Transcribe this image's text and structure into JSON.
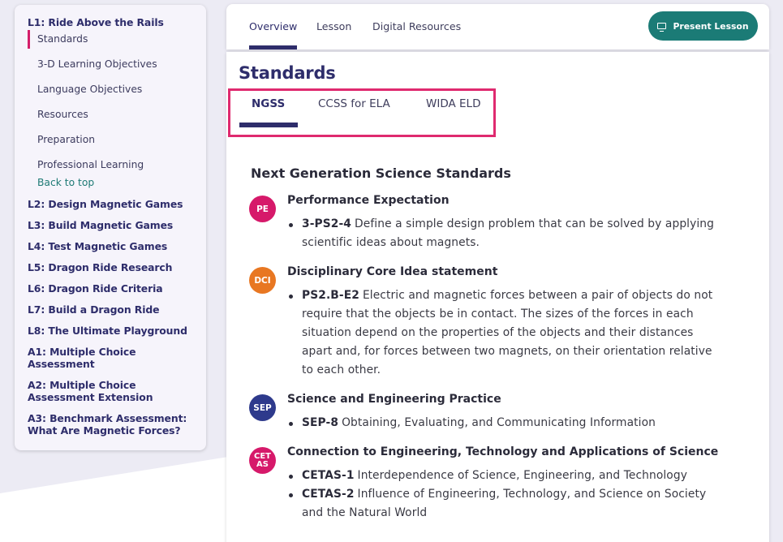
{
  "sidebar": {
    "current_lesson": "L1: Ride Above the Rails",
    "sub_items": [
      {
        "label": "Standards",
        "active": true
      },
      {
        "label": "3-D Learning Objectives"
      },
      {
        "label": "Language Objectives"
      },
      {
        "label": "Resources"
      },
      {
        "label": "Preparation"
      },
      {
        "label": "Professional Learning"
      }
    ],
    "back_to_top": "Back to top",
    "lessons": [
      "L2: Design Magnetic Games",
      "L3: Build Magnetic Games",
      "L4: Test Magnetic Games",
      "L5: Dragon Ride Research",
      "L6: Dragon Ride Criteria",
      "L7: Build a Dragon Ride",
      "L8: The Ultimate Playground",
      "A1: Multiple Choice Assessment",
      "A2: Multiple Choice Assessment Extension",
      "A3: Benchmark Assessment: What Are Magnetic Forces?"
    ]
  },
  "topbar": {
    "tabs": [
      "Overview",
      "Lesson",
      "Digital Resources"
    ],
    "active_tab": "Overview",
    "present_button": "Present Lesson",
    "present_icon": "presentation-screen-icon"
  },
  "main": {
    "heading": "Standards",
    "standard_tabs": [
      "NGSS",
      "CCSS for ELA",
      "WIDA ELD"
    ],
    "active_standard_tab": "NGSS",
    "section_title": "Next Generation Science Standards",
    "groups": [
      {
        "badge": "PE",
        "badge_color": "#d6196a",
        "title": "Performance Expectation",
        "items": [
          {
            "code": "3-PS2-4",
            "text": "Define a simple design problem that can be solved by applying scientific ideas about magnets."
          }
        ]
      },
      {
        "badge": "DCI",
        "badge_color": "#e87722",
        "title": "Disciplinary Core Idea statement",
        "items": [
          {
            "code": "PS2.B-E2",
            "text": "Electric and magnetic forces between a pair of objects do not require that the objects be in contact. The sizes of the forces in each situation depend on the properties of the objects and their distances apart and, for forces between two magnets, on their orientation relative to each other."
          }
        ]
      },
      {
        "badge": "SEP",
        "badge_color": "#2e3a8c",
        "title": "Science and Engineering Practice",
        "items": [
          {
            "code": "SEP-8",
            "text": "Obtaining, Evaluating, and Communicating Information"
          }
        ]
      },
      {
        "badge": "CET AS",
        "badge_color": "#d6196a",
        "title": "Connection to Engineering, Technology and Applications of Science",
        "items": [
          {
            "code": "CETAS-1",
            "text": "Interdependence of Science, Engineering, and Technology"
          },
          {
            "code": "CETAS-2",
            "text": "Influence of Engineering, Technology, and Science on Society and the Natural World"
          }
        ]
      }
    ]
  },
  "colors": {
    "accent_navy": "#2e2d6b",
    "teal": "#1b7b76",
    "highlight_pink": "#df2a6f"
  }
}
